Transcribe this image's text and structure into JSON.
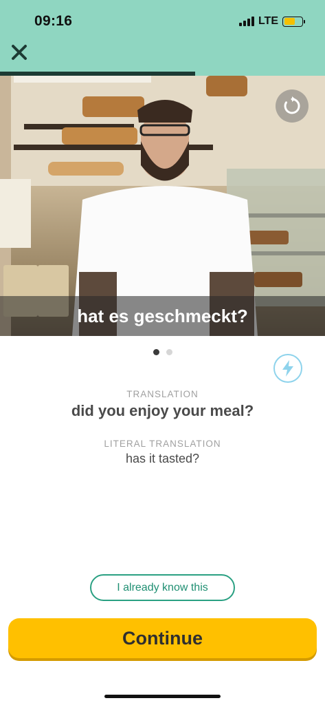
{
  "status_bar": {
    "time": "09:16",
    "network": "LTE",
    "battery_level": 0.62
  },
  "lesson": {
    "progress": 0.6,
    "close_icon": "close-icon"
  },
  "video": {
    "subtitle": "hat es geschmeckt?",
    "replay_icon": "replay-icon"
  },
  "pager": {
    "count": 2,
    "active_index": 0
  },
  "translation": {
    "label": "TRANSLATION",
    "text": "did you enjoy your meal?",
    "literal_label": "LITERAL TRANSLATION",
    "literal_text": "has it tasted?"
  },
  "actions": {
    "bolt_icon": "lightning-bolt-icon",
    "already_know": "I already know this",
    "continue": "Continue"
  },
  "colors": {
    "header": "#8fd6c1",
    "progress": "#1d3b34",
    "accent_green": "#2aa082",
    "continue_yellow": "#ffc000",
    "bolt_blue": "#8ed3ec"
  }
}
